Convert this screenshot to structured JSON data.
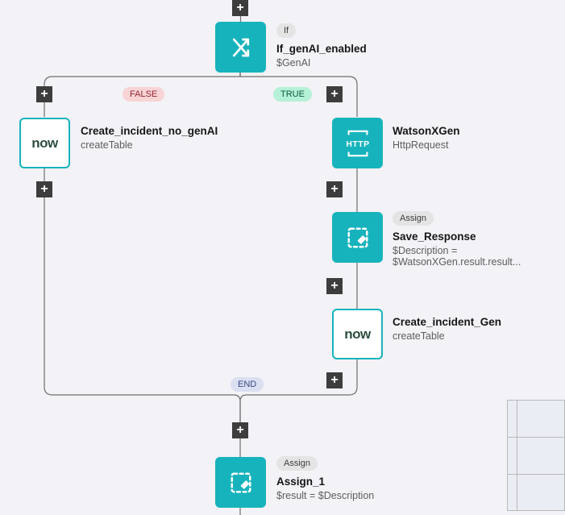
{
  "branchLabels": {
    "false": "FALSE",
    "true": "TRUE",
    "end": "END"
  },
  "nodes": {
    "if": {
      "tag": "If",
      "title": "If_genAI_enabled",
      "sub": "$GenAI"
    },
    "falseNode": {
      "title": "Create_incident_no_genAI",
      "sub": "createTable"
    },
    "watson": {
      "title": "WatsonXGen",
      "sub": "HttpRequest"
    },
    "save": {
      "tag": "Assign",
      "title": "Save_Response",
      "sub": "$Description = $WatsonXGen.result.result..."
    },
    "createGen": {
      "title": "Create_incident_Gen",
      "sub": "createTable"
    },
    "assign1": {
      "tag": "Assign",
      "title": "Assign_1",
      "sub": "$result = $Description"
    }
  }
}
